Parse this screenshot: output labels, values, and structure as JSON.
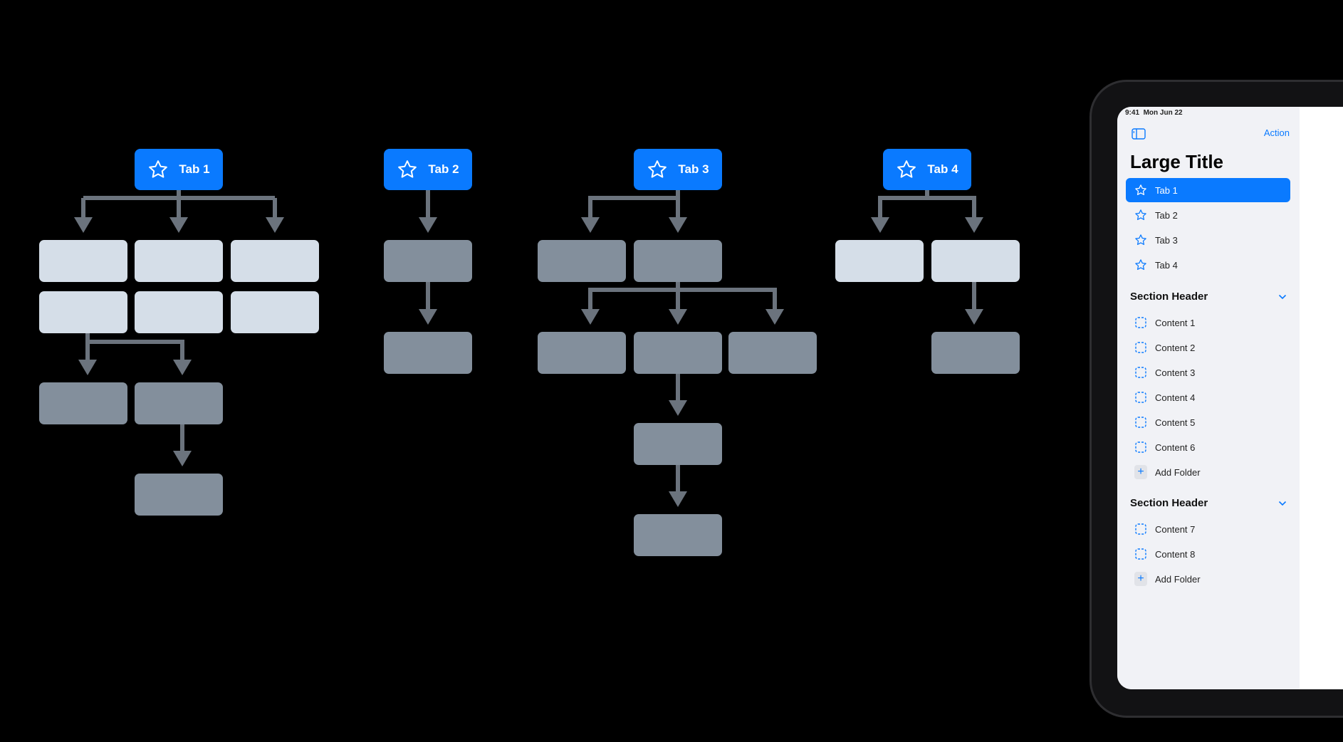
{
  "colors": {
    "accent": "#0A7AFF",
    "node_light": "#D5DEE8",
    "node_dark": "#838F9C",
    "arrow": "#6B737D"
  },
  "diagram": {
    "tabs": [
      {
        "label": "Tab 1",
        "icon": "star-icon"
      },
      {
        "label": "Tab 2",
        "icon": "star-icon"
      },
      {
        "label": "Tab 3",
        "icon": "star-icon"
      },
      {
        "label": "Tab 4",
        "icon": "star-icon"
      }
    ]
  },
  "ipad": {
    "status_bar": {
      "time": "9:41",
      "date": "Mon Jun 22"
    },
    "nav": {
      "sidebar_toggle_icon": "sidebar-icon",
      "action_label": "Action"
    },
    "large_title": "Large Title",
    "tabs": [
      {
        "label": "Tab 1",
        "selected": true
      },
      {
        "label": "Tab 2"
      },
      {
        "label": "Tab 3"
      },
      {
        "label": "Tab 4"
      }
    ],
    "sections": [
      {
        "header": "Section Header",
        "items": [
          "Content 1",
          "Content 2",
          "Content 3",
          "Content 4",
          "Content 5",
          "Content 6"
        ],
        "add_label": "Add Folder"
      },
      {
        "header": "Section Header",
        "items": [
          "Content 7",
          "Content 8"
        ],
        "add_label": "Add Folder"
      }
    ]
  }
}
